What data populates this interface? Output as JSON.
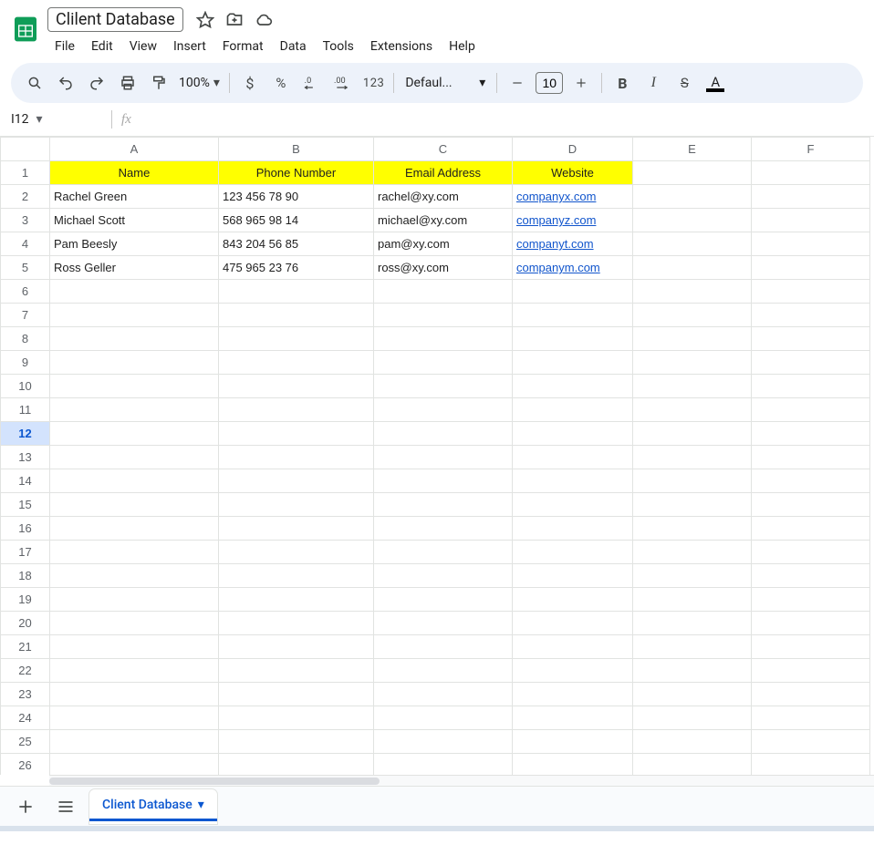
{
  "doc": {
    "title": "Clilent Database"
  },
  "menu": {
    "file": "File",
    "edit": "Edit",
    "view": "View",
    "insert": "Insert",
    "format": "Format",
    "data": "Data",
    "tools": "Tools",
    "extensions": "Extensions",
    "help": "Help"
  },
  "toolbar": {
    "zoom": "100%",
    "fmt123": "123",
    "font": "Defaul...",
    "size": "10"
  },
  "namebox": {
    "cell": "I12"
  },
  "columns": {
    "A": "A",
    "B": "B",
    "C": "C",
    "D": "D",
    "E": "E",
    "F": "F"
  },
  "headers": {
    "name": "Name",
    "phone": "Phone Number",
    "email": "Email Address",
    "website": "Website"
  },
  "rows": [
    {
      "n": "1"
    },
    {
      "n": "2",
      "name": "Rachel Green",
      "phone": "123 456 78 90",
      "email": "rachel@xy.com",
      "website": "companyx.com"
    },
    {
      "n": "3",
      "name": "Michael Scott",
      "phone": "568 965 98 14",
      "email": "michael@xy.com",
      "website": "companyz.com"
    },
    {
      "n": "4",
      "name": "Pam Beesly",
      "phone": "843 204 56 85",
      "email": "pam@xy.com",
      "website": "companyt.com"
    },
    {
      "n": "5",
      "name": "Ross Geller",
      "phone": "475 965 23 76",
      "email": "ross@xy.com",
      "website": "companym.com"
    },
    {
      "n": "6"
    },
    {
      "n": "7"
    },
    {
      "n": "8"
    },
    {
      "n": "9"
    },
    {
      "n": "10"
    },
    {
      "n": "11"
    },
    {
      "n": "12"
    },
    {
      "n": "13"
    },
    {
      "n": "14"
    },
    {
      "n": "15"
    },
    {
      "n": "16"
    },
    {
      "n": "17"
    },
    {
      "n": "18"
    },
    {
      "n": "19"
    },
    {
      "n": "20"
    },
    {
      "n": "21"
    },
    {
      "n": "22"
    },
    {
      "n": "23"
    },
    {
      "n": "24"
    },
    {
      "n": "25"
    },
    {
      "n": "26"
    }
  ],
  "sheet": {
    "tab": "Client Database"
  }
}
